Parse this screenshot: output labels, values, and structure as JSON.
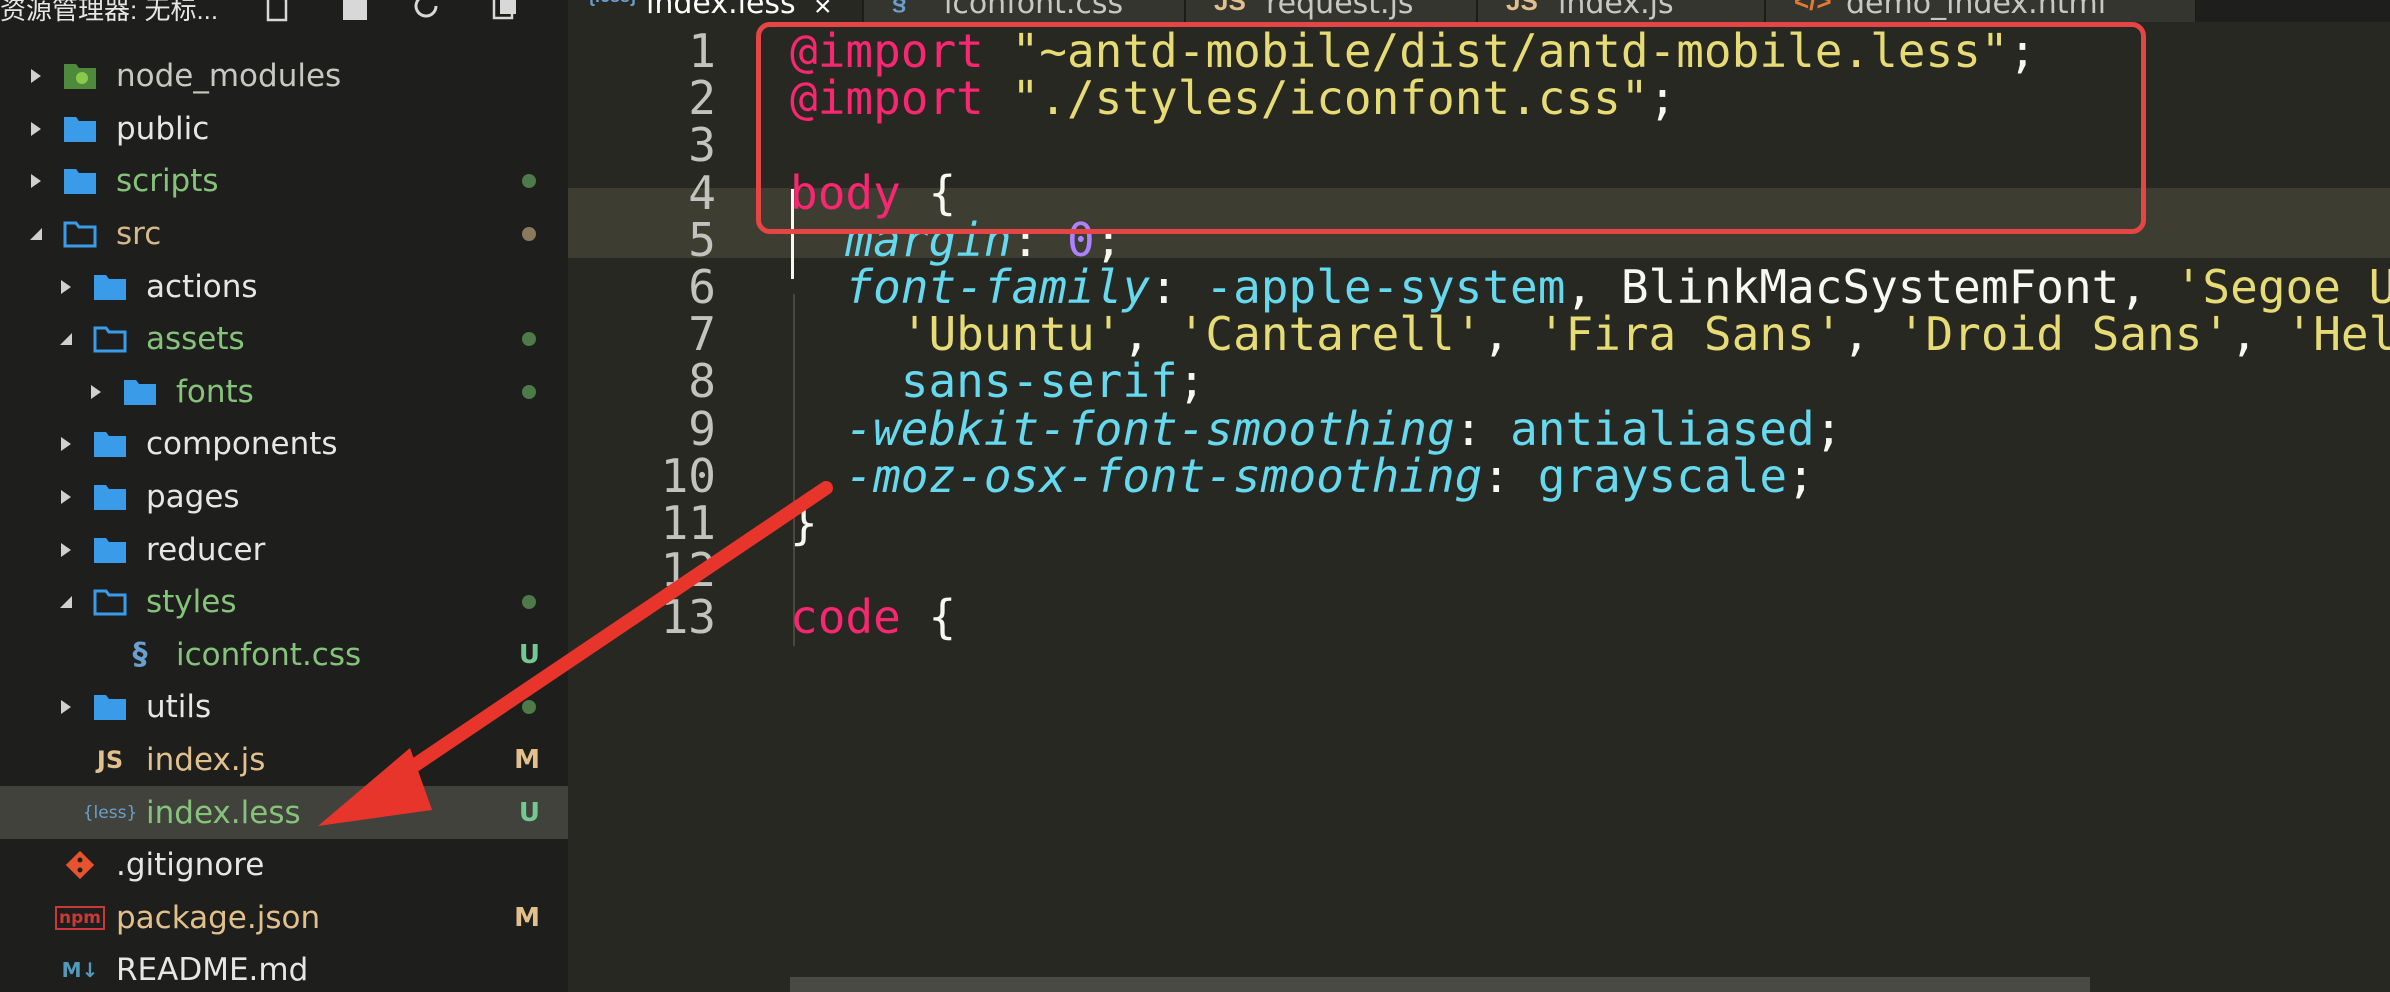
{
  "sidebar": {
    "title": "资源管理器: 无标...",
    "items": [
      {
        "label": "node_modules",
        "type": "folder-special",
        "expanded": false,
        "color": "#c8c8c2",
        "status": ""
      },
      {
        "label": "public",
        "type": "folder",
        "expanded": false,
        "color": "#e6e6e6",
        "status": ""
      },
      {
        "label": "scripts",
        "type": "folder",
        "expanded": false,
        "color": "#86c37a",
        "status": "dot"
      },
      {
        "label": "src",
        "type": "folder",
        "expanded": true,
        "color": "#d6b98b",
        "status": "dot"
      },
      {
        "label": "actions",
        "type": "folder",
        "expanded": false,
        "color": "#e6e6e6",
        "status": ""
      },
      {
        "label": "assets",
        "type": "folder",
        "expanded": true,
        "color": "#86c37a",
        "status": "dot"
      },
      {
        "label": "fonts",
        "type": "folder",
        "expanded": false,
        "color": "#86c37a",
        "status": "dot"
      },
      {
        "label": "components",
        "type": "folder",
        "expanded": false,
        "color": "#e6e6e6",
        "status": ""
      },
      {
        "label": "pages",
        "type": "folder",
        "expanded": false,
        "color": "#e6e6e6",
        "status": ""
      },
      {
        "label": "reducer",
        "type": "folder",
        "expanded": false,
        "color": "#e6e6e6",
        "status": ""
      },
      {
        "label": "styles",
        "type": "folder",
        "expanded": true,
        "color": "#86c37a",
        "status": "dot"
      },
      {
        "label": "iconfont.css",
        "type": "css",
        "color": "#86c37a",
        "status": "U"
      },
      {
        "label": "utils",
        "type": "folder",
        "expanded": false,
        "color": "#e6e6e6",
        "status": "dot"
      },
      {
        "label": "index.js",
        "type": "js",
        "color": "#e2c08d",
        "status": "M"
      },
      {
        "label": "index.less",
        "type": "less",
        "color": "#86c37a",
        "status": "U",
        "selected": true
      },
      {
        "label": ".gitignore",
        "type": "git",
        "color": "#e6e6e6",
        "status": ""
      },
      {
        "label": "package.json",
        "type": "npm",
        "color": "#e2c08d",
        "status": "M"
      },
      {
        "label": "README.md",
        "type": "md",
        "color": "#e6e6e6",
        "status": ""
      }
    ]
  },
  "tabs": [
    {
      "icon": "{less}",
      "label": "index.less",
      "active": true,
      "close": "×"
    },
    {
      "icon": "§",
      "label": "iconfont.css",
      "active": false
    },
    {
      "icon": "JS",
      "label": "request.js",
      "active": false
    },
    {
      "icon": "JS",
      "label": "index.js",
      "active": false
    },
    {
      "icon": "</>",
      "label": "demo_index.html",
      "active": false
    }
  ],
  "editor": {
    "line_numbers": [
      "1",
      "2",
      "3",
      "4",
      "5",
      "6",
      "7",
      "8",
      "9",
      "10",
      "11",
      "12",
      "13"
    ],
    "lines": [
      [
        [
          "kw",
          "@import"
        ],
        [
          "plain",
          " "
        ],
        [
          "str",
          "\"~antd-mobile/dist/antd-mobile.less\""
        ],
        [
          "plain",
          ";"
        ]
      ],
      [
        [
          "kw",
          "@import"
        ],
        [
          "plain",
          " "
        ],
        [
          "str",
          "\"./styles/iconfont.css\""
        ],
        [
          "plain",
          ";"
        ]
      ],
      [],
      [
        [
          "kw",
          "body"
        ],
        [
          "plain",
          " {"
        ]
      ],
      [
        [
          "plain",
          "  "
        ],
        [
          "prop",
          "margin"
        ],
        [
          "plain",
          ": "
        ],
        [
          "num",
          "0"
        ],
        [
          "plain",
          ";"
        ]
      ],
      [
        [
          "plain",
          "  "
        ],
        [
          "prop",
          "font-family"
        ],
        [
          "plain",
          ": "
        ],
        [
          "val",
          "-apple-system"
        ],
        [
          "plain",
          ", BlinkMacSystemFont, "
        ],
        [
          "str",
          "'Segoe UI'"
        ]
      ],
      [
        [
          "plain",
          "    "
        ],
        [
          "str",
          "'Ubuntu'"
        ],
        [
          "plain",
          ", "
        ],
        [
          "str",
          "'Cantarell'"
        ],
        [
          "plain",
          ", "
        ],
        [
          "str",
          "'Fira Sans'"
        ],
        [
          "plain",
          ", "
        ],
        [
          "str",
          "'Droid Sans'"
        ],
        [
          "plain",
          ", "
        ],
        [
          "str",
          "'Helvetica Neue'"
        ]
      ],
      [
        [
          "plain",
          "    "
        ],
        [
          "val",
          "sans-serif"
        ],
        [
          "plain",
          ";"
        ]
      ],
      [
        [
          "plain",
          "  "
        ],
        [
          "prop",
          "-webkit-font-smoothing"
        ],
        [
          "plain",
          ": "
        ],
        [
          "val",
          "antialiased"
        ],
        [
          "plain",
          ";"
        ]
      ],
      [
        [
          "plain",
          "  "
        ],
        [
          "prop",
          "-moz-osx-font-smoothing"
        ],
        [
          "plain",
          ": "
        ],
        [
          "val",
          "grayscale"
        ],
        [
          "plain",
          ";"
        ]
      ],
      [
        [
          "plain",
          "}"
        ]
      ],
      [],
      [
        [
          "kw",
          "code"
        ],
        [
          "plain",
          " {"
        ]
      ]
    ]
  },
  "colors": {
    "highlight": "#e64545",
    "arrow": "#e8352b"
  }
}
